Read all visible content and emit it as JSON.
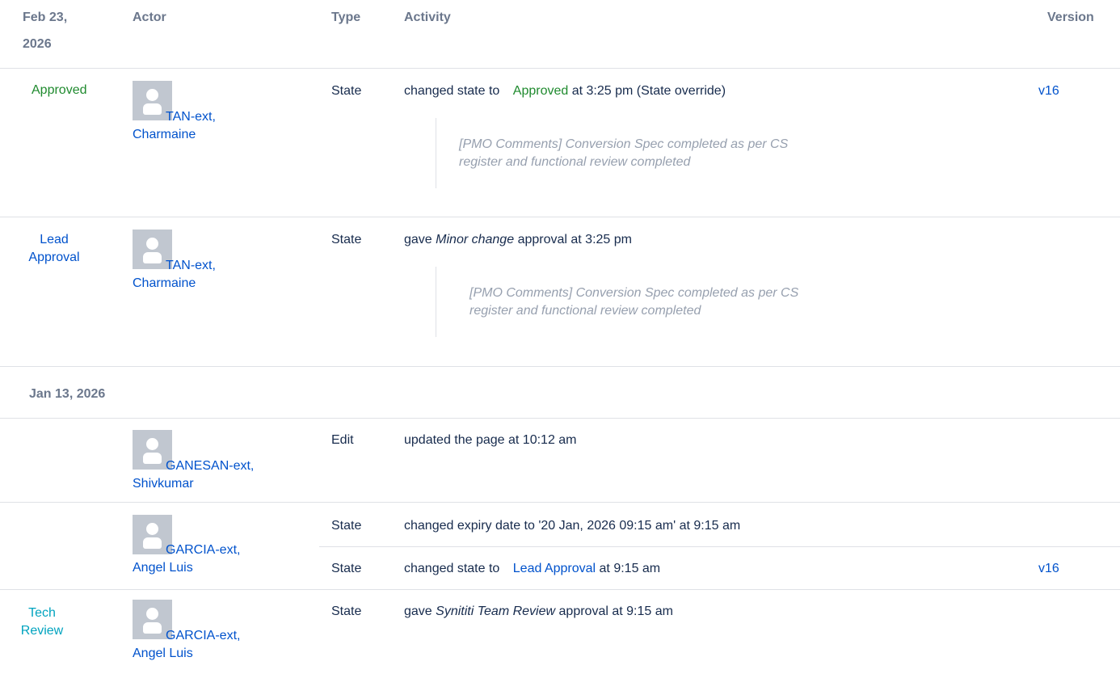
{
  "header": {
    "date_line1": "Feb 23,",
    "date_line2": "2026",
    "actor": "Actor",
    "type": "Type",
    "activity": "Activity",
    "version": "Version"
  },
  "groups": [
    {
      "rows": [
        {
          "state_badge": "Approved",
          "actor_line1": "TAN-ext,",
          "actor_line2": "Charmaine",
          "type": "State",
          "activity_prefix": "changed state to",
          "activity_state": "Approved",
          "activity_suffix": "at 3:25 pm (State override)",
          "comment_line1": "[PMO Comments] Conversion Spec completed as per CS",
          "comment_line2": "register and functional review completed",
          "version": "v16"
        },
        {
          "state_badge_line1": "Lead",
          "state_badge_line2": "Approval",
          "actor_line1": "TAN-ext,",
          "actor_line2": "Charmaine",
          "type": "State",
          "activity_prefix": "gave",
          "activity_italic": "Minor change",
          "activity_suffix": "approval at 3:25 pm",
          "comment_line1": "[PMO Comments] Conversion Spec completed as per CS",
          "comment_line2": "register and functional review completed"
        }
      ]
    },
    {
      "date": "Jan 13, 2026",
      "rows": [
        {
          "actor_line1": "GANESAN-ext,",
          "actor_line2": "Shivkumar",
          "type": "Edit",
          "activity": "updated the page at 10:12 am"
        },
        {
          "actor_line1": "GARCIA-ext,",
          "actor_line2": "Angel Luis",
          "sub": [
            {
              "type": "State",
              "activity": "changed expiry date to '20 Jan, 2026 09:15 am' at 9:15 am"
            },
            {
              "type": "State",
              "activity_prefix": "changed state to",
              "activity_state": "Lead Approval",
              "activity_suffix": "at 9:15 am",
              "version": "v16"
            }
          ]
        },
        {
          "state_badge_line1": "Tech",
          "state_badge_line2": "Review",
          "actor_line1": "GARCIA-ext,",
          "actor_line2": "Angel Luis",
          "type": "State",
          "activity_prefix": "gave",
          "activity_italic": "Synititi Team Review",
          "activity_suffix": "approval at 9:15 am"
        }
      ]
    }
  ]
}
